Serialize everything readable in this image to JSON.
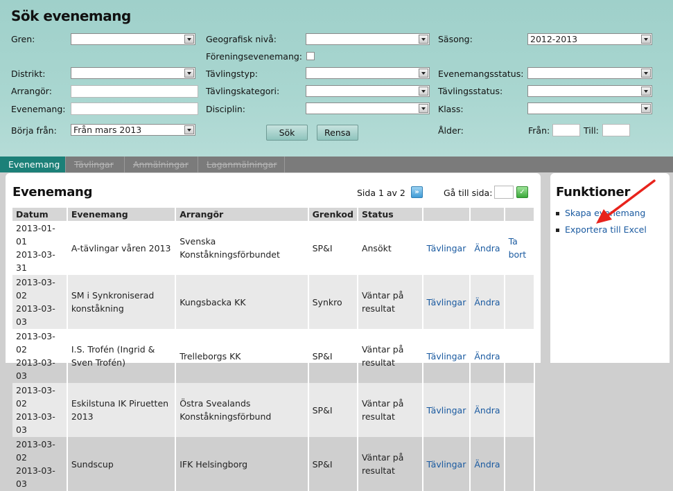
{
  "search": {
    "title": "Sök evenemang",
    "gren_label": "Gren:",
    "gren_value": "",
    "geo_label": "Geografisk nivå:",
    "geo_value": "",
    "sasong_label": "Säsong:",
    "sasong_value": "2012-2013",
    "forening_label": "Föreningsevenemang:",
    "distrikt_label": "Distrikt:",
    "tavlingstyp_label": "Tävlingstyp:",
    "evstatus_label": "Evenemangsstatus:",
    "arrangor_label": "Arrangör:",
    "tavlingskategori_label": "Tävlingskategori:",
    "tavlingsstatus_label": "Tävlingsstatus:",
    "evenemang_label": "Evenemang:",
    "disciplin_label": "Disciplin:",
    "klass_label": "Klass:",
    "borja_label": "Börja från:",
    "borja_value": "Från mars 2013",
    "sok_button": "Sök",
    "rensa_button": "Rensa",
    "alder_label": "Ålder:",
    "fran_label": "Från:",
    "till_label": "Till:"
  },
  "tabs": [
    "Evenemang",
    "Tävlingar",
    "Anmälningar",
    "Laganmälningar"
  ],
  "events": {
    "heading": "Evenemang",
    "page_info": "Sida 1 av 2",
    "goto_label": "Gå till sida:",
    "columns": [
      "Datum",
      "Evenemang",
      "Arrangör",
      "Grenkod",
      "Status",
      "",
      "",
      ""
    ],
    "rows": [
      {
        "date1": "2013-01-01",
        "date2": "2013-03-31",
        "name": "A-tävlingar våren 2013",
        "org": "Svenska Konståkningsförbundet",
        "code": "SP&I",
        "status": "Ansökt",
        "l1": "Tävlingar",
        "l2": "Ändra",
        "l3": "Ta bort"
      },
      {
        "date1": "2013-03-02",
        "date2": "2013-03-03",
        "name": "SM i Synkroniserad konståkning",
        "org": "Kungsbacka KK",
        "code": "Synkro",
        "status": "Väntar på resultat",
        "l1": "Tävlingar",
        "l2": "Ändra",
        "l3": ""
      },
      {
        "date1": "2013-03-02",
        "date2": "2013-03-03",
        "name": "I.S. Trofén (Ingrid & Sven Trofén)",
        "org": "Trelleborgs KK",
        "code": "SP&I",
        "status": "Väntar på resultat",
        "l1": "Tävlingar",
        "l2": "Ändra",
        "l3": ""
      },
      {
        "date1": "2013-03-02",
        "date2": "2013-03-03",
        "name": "Eskilstuna IK Piruetten 2013",
        "org": "Östra Svealands Konståkningsförbund",
        "code": "SP&I",
        "status": "Väntar på resultat",
        "l1": "Tävlingar",
        "l2": "Ändra",
        "l3": ""
      },
      {
        "date1": "2013-03-02",
        "date2": "2013-03-03",
        "name": "Sundscup",
        "org": "IFK Helsingborg",
        "code": "SP&I",
        "status": "Väntar på resultat",
        "l1": "Tävlingar",
        "l2": "Ändra",
        "l3": ""
      }
    ]
  },
  "functions": {
    "heading": "Funktioner",
    "items": [
      "Skapa evenemang",
      "Exportera till Excel"
    ]
  },
  "colors": {
    "arrow": "#e8231c",
    "link": "#1a5aa0",
    "panel": "#a9d6d0",
    "active_tab": "#1c8078"
  }
}
